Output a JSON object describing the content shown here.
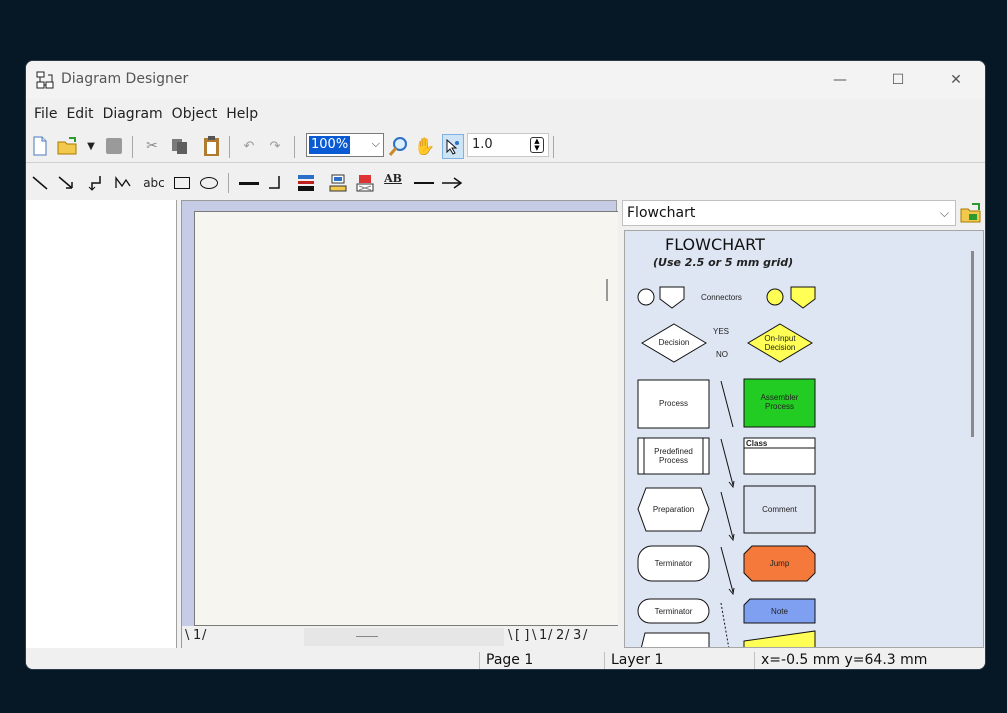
{
  "window": {
    "title": "Diagram Designer"
  },
  "menu": [
    "File",
    "Edit",
    "Diagram",
    "Object",
    "Help"
  ],
  "toolbar": {
    "zoom_value": "100%",
    "spin_value": "1.0"
  },
  "toolbar2": {
    "text_tool_label": "abc",
    "text_style_label": "AB"
  },
  "canvas": {
    "page_tabs": [
      "1",
      "[ ]",
      "1",
      "2",
      "3"
    ]
  },
  "library": {
    "selected": "Flowchart",
    "stencil_title": "FLOWCHART",
    "stencil_subtitle": "(Use 2.5 or 5 mm grid)",
    "connectors_label": "Connectors",
    "yes_label": "YES",
    "no_label": "NO",
    "shapes": {
      "decision": "Decision",
      "on_input_decision_1": "On-Input",
      "on_input_decision_2": "Decision",
      "process": "Process",
      "assembler_process_1": "Assembler",
      "assembler_process_2": "Process",
      "predefined_process_1": "Predefined",
      "predefined_process_2": "Process",
      "class": "Class",
      "preparation": "Preparation",
      "comment": "Comment",
      "terminator": "Terminator",
      "jump": "Jump",
      "terminator2": "Terminator",
      "note": "Note"
    }
  },
  "status": {
    "page": "Page 1",
    "layer": "Layer 1",
    "coords": "x=-0.5 mm  y=64.3 mm"
  },
  "colors": {
    "decision_yellow": "#ffff55",
    "assembler_green": "#22cc22",
    "jump_orange": "#f4793b",
    "note_blue": "#7f9ff0"
  }
}
